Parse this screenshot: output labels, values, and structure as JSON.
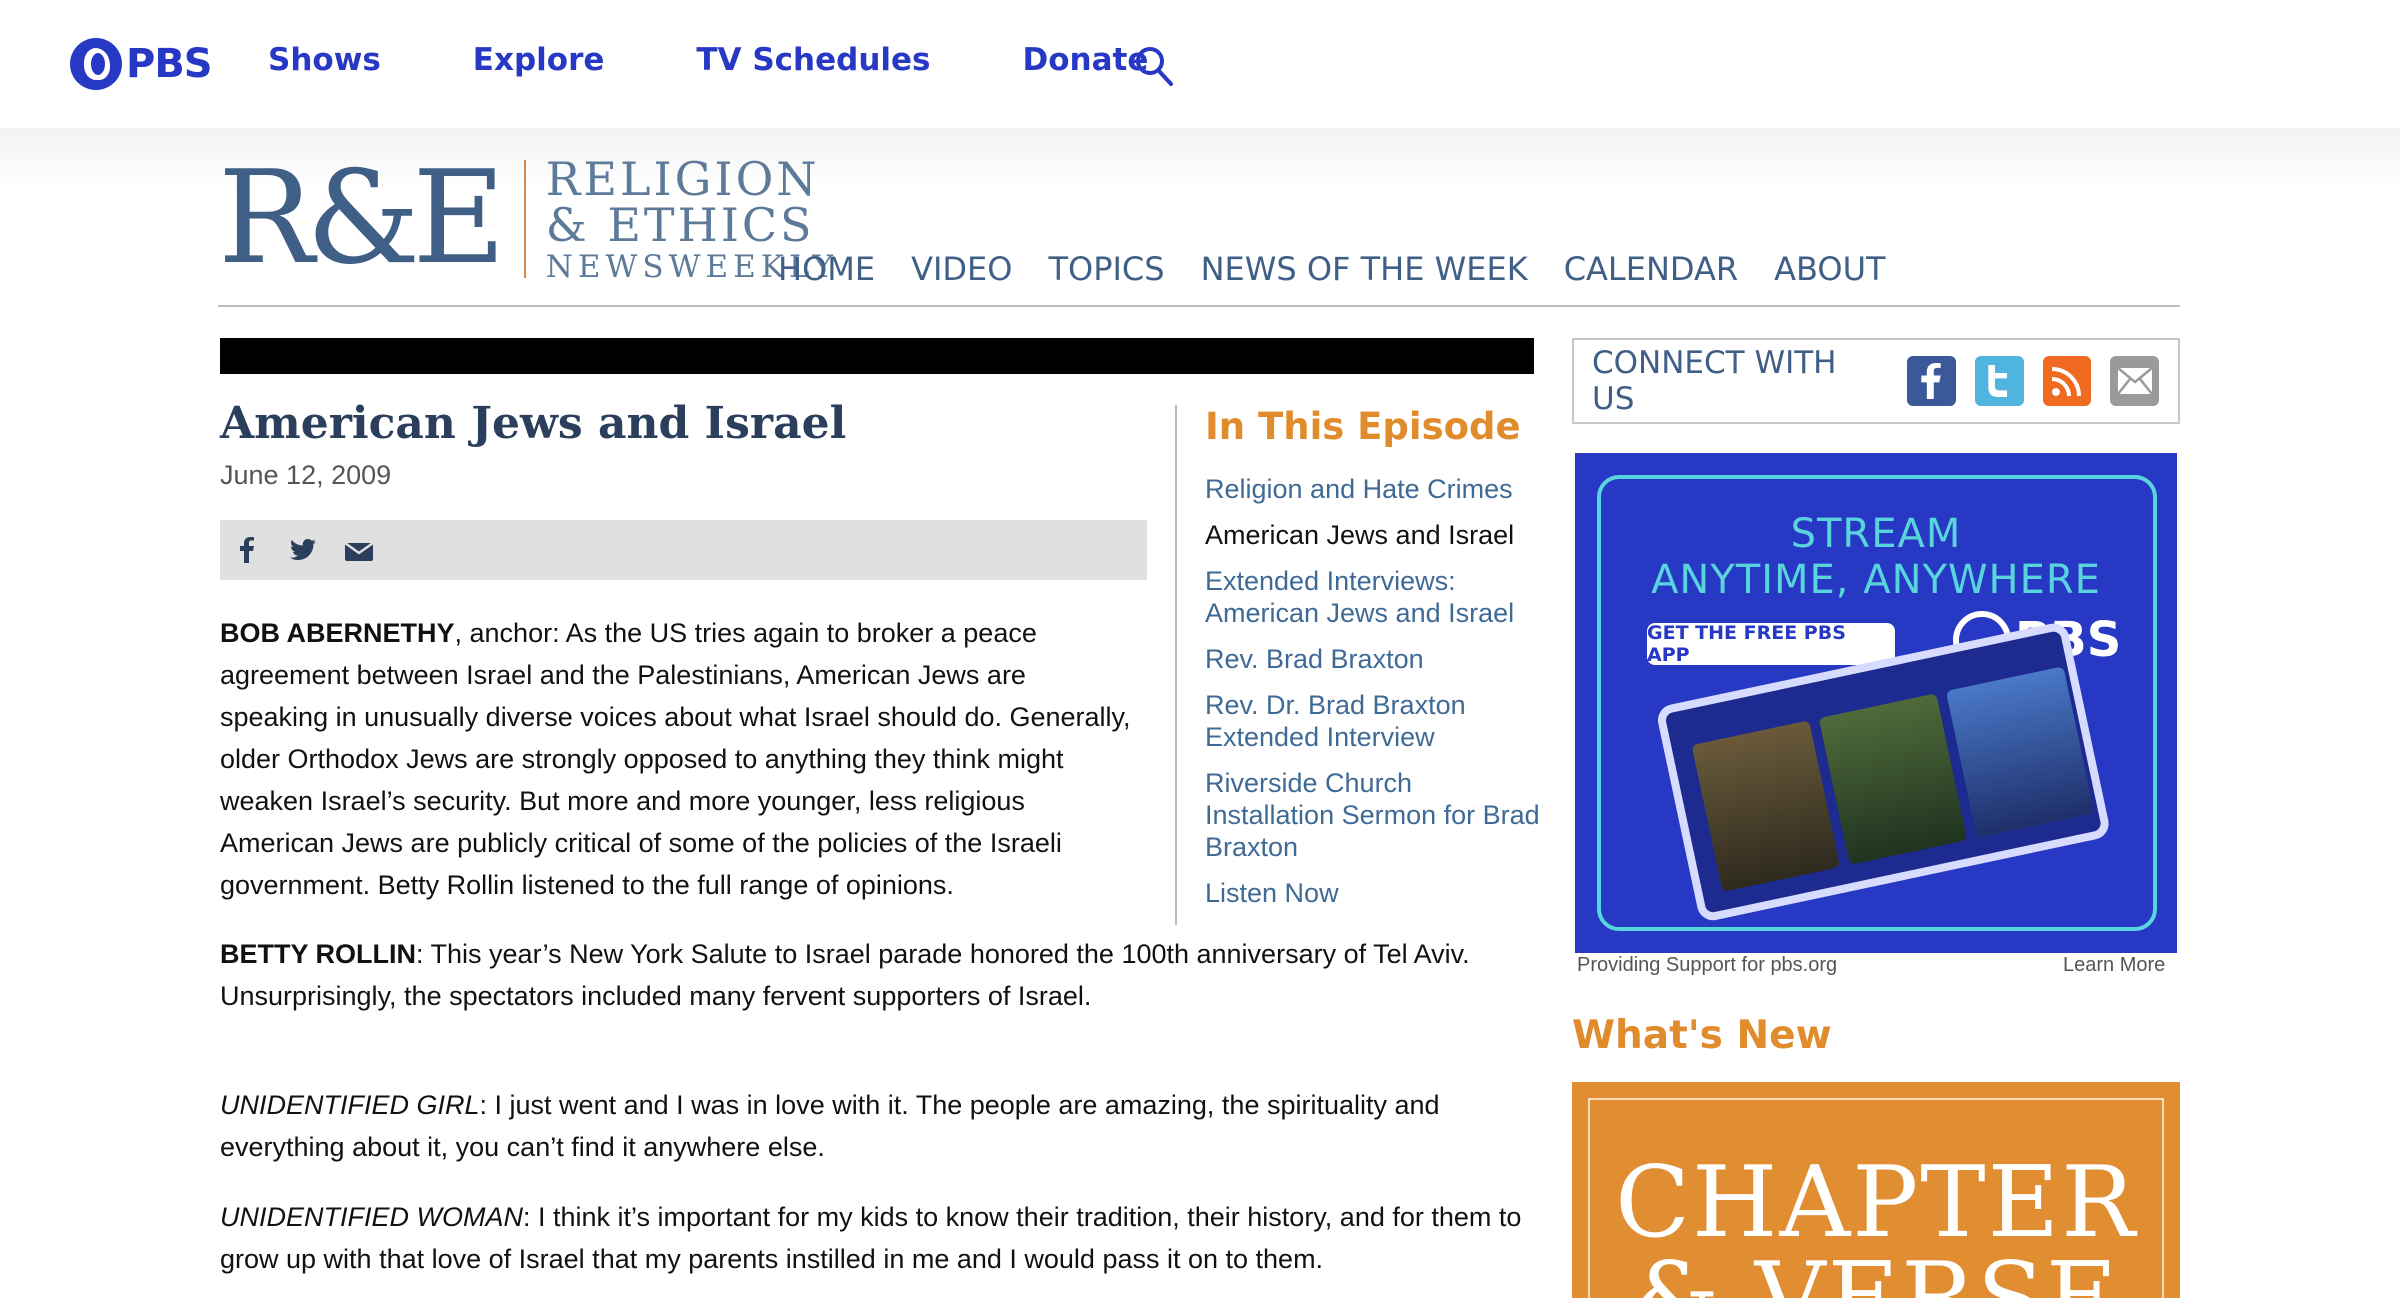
{
  "pbs": {
    "logo_text": "PBS",
    "nav": [
      "Shows",
      "Explore",
      "TV Schedules",
      "Donate"
    ],
    "search_icon": "search-icon",
    "brand_color": "#2638c4"
  },
  "re": {
    "logo_mark": "R&E",
    "logo_line1": "RELIGION",
    "logo_line2": "& ETHICS",
    "logo_line3": "NEWSWEEKLY",
    "nav": [
      "HOME",
      "VIDEO",
      "TOPICS",
      "NEWS OF THE WEEK",
      "CALENDAR",
      "ABOUT"
    ]
  },
  "article": {
    "title": "American Jews and Israel",
    "date": "June 12, 2009",
    "share_icons": [
      "facebook-icon",
      "twitter-icon",
      "email-icon"
    ],
    "paragraphs": [
      {
        "speaker": "BOB ABERNETHY",
        "speaker_style": "bold",
        "text": ", anchor: As the US tries again to broker a peace agreement between Israel and the Palestinians, American Jews are speaking in unusually diverse voices about what Israel should do. Generally, older Orthodox Jews are strongly opposed to anything they think might weaken Israel’s security. But more and more younger, less religious American Jews are publicly critical of some of the policies of the Israeli government. Betty Rollin listened to the full range of opinions."
      },
      {
        "speaker": "BETTY ROLLIN",
        "speaker_style": "bold",
        "text": ": This year’s New York Salute to Israel parade honored the 100th anniversary of Tel Aviv. Unsurprisingly, the spectators included many fervent supporters of Israel."
      },
      {
        "speaker": "UNIDENTIFIED GIRL",
        "speaker_style": "italic",
        "text": ": I just went and I was in love with it. The people are amazing, the spirituality and everything about it, you can’t find it anywhere else."
      },
      {
        "speaker": "UNIDENTIFIED WOMAN",
        "speaker_style": "italic",
        "text": ": I think it’s important for my kids to know their tradition, their history, and for them to grow up with that love of Israel that my parents instilled in me and I would pass it on to them."
      }
    ]
  },
  "episode": {
    "heading": "In This Episode",
    "items": [
      {
        "label": "Religion and Hate Crimes",
        "current": false
      },
      {
        "label": "American Jews and Israel",
        "current": true
      },
      {
        "label": "Extended Interviews: American Jews and Israel",
        "current": false
      },
      {
        "label": "Rev. Brad Braxton",
        "current": false
      },
      {
        "label": "Rev. Dr. Brad Braxton Extended Interview",
        "current": false
      },
      {
        "label": "Riverside Church Installation Sermon for Brad Braxton",
        "current": false
      },
      {
        "label": "Listen Now",
        "current": false
      }
    ]
  },
  "sidebar": {
    "connect_label": "CONNECT WITH US",
    "social_icons": [
      {
        "name": "facebook-icon",
        "color": "#3b5998",
        "glyph": "f"
      },
      {
        "name": "twitter-icon",
        "color": "#4fb5e0",
        "glyph": "t"
      },
      {
        "name": "rss-icon",
        "color": "#f06a22",
        "glyph": ")"
      },
      {
        "name": "mail-icon",
        "color": "#9a9a9a",
        "glyph": "✉"
      }
    ],
    "ad": {
      "title_line1": "STREAM",
      "title_line2": "ANYTIME, ANYWHERE",
      "button": "GET THE FREE PBS APP",
      "logo_text": "PBS",
      "support_text": "Providing Support for pbs.org",
      "learn_more": "Learn More"
    },
    "whats_new": "What's New",
    "promo_line1": "CHAPTER",
    "promo_line2": "& VERSE"
  },
  "colors": {
    "accent_orange": "#e08c2c",
    "re_blue": "#3f5f86",
    "link_blue": "#3f6a96"
  }
}
